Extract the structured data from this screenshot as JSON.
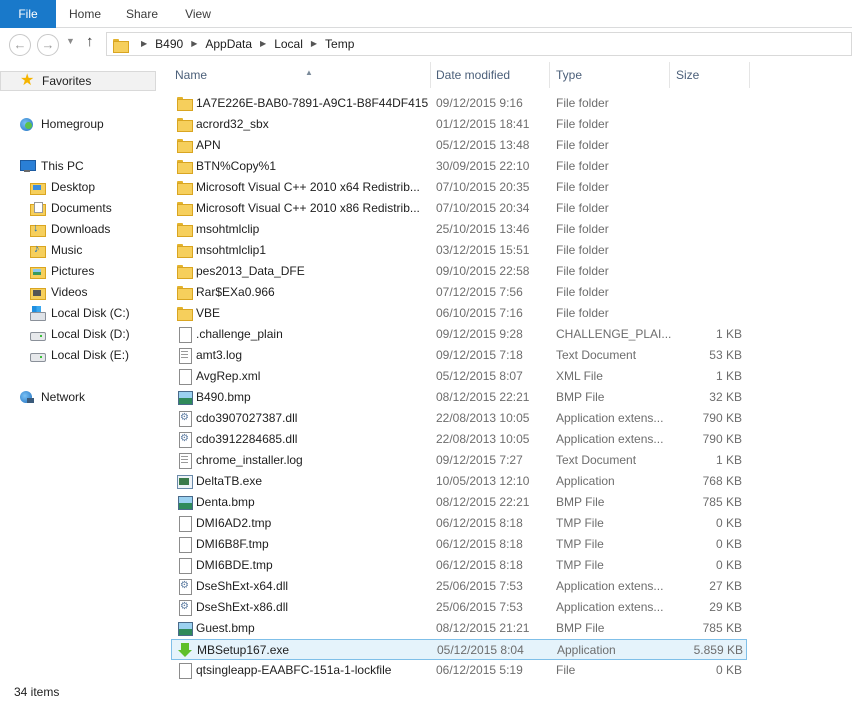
{
  "ribbon": {
    "file": "File",
    "home": "Home",
    "share": "Share",
    "view": "View"
  },
  "address": {
    "crumbs": [
      "B490",
      "AppData",
      "Local",
      "Temp"
    ]
  },
  "sidebar": {
    "favorites": "Favorites",
    "homegroup": "Homegroup",
    "this_pc": "This PC",
    "pc_items": [
      "Desktop",
      "Documents",
      "Downloads",
      "Music",
      "Pictures",
      "Videos",
      "Local Disk (C:)",
      "Local Disk (D:)",
      "Local Disk (E:)"
    ],
    "network": "Network"
  },
  "columns": {
    "name": "Name",
    "date": "Date modified",
    "type": "Type",
    "size": "Size"
  },
  "files": [
    {
      "name": "1A7E226E-BAB0-7891-A9C1-B8F44DF415...",
      "date": "09/12/2015 9:16",
      "type": "File folder",
      "size": "",
      "icon": "folder-icon"
    },
    {
      "name": "acrord32_sbx",
      "date": "01/12/2015 18:41",
      "type": "File folder",
      "size": "",
      "icon": "folder-icon"
    },
    {
      "name": "APN",
      "date": "05/12/2015 13:48",
      "type": "File folder",
      "size": "",
      "icon": "folder-icon"
    },
    {
      "name": "BTN%Copy%1",
      "date": "30/09/2015 22:10",
      "type": "File folder",
      "size": "",
      "icon": "folder-icon"
    },
    {
      "name": "Microsoft Visual C++ 2010  x64 Redistrib...",
      "date": "07/10/2015 20:35",
      "type": "File folder",
      "size": "",
      "icon": "folder-icon"
    },
    {
      "name": "Microsoft Visual C++ 2010  x86 Redistrib...",
      "date": "07/10/2015 20:34",
      "type": "File folder",
      "size": "",
      "icon": "folder-icon"
    },
    {
      "name": "msohtmlclip",
      "date": "25/10/2015 13:46",
      "type": "File folder",
      "size": "",
      "icon": "folder-icon"
    },
    {
      "name": "msohtmlclip1",
      "date": "03/12/2015 15:51",
      "type": "File folder",
      "size": "",
      "icon": "folder-icon"
    },
    {
      "name": "pes2013_Data_DFE",
      "date": "09/10/2015 22:58",
      "type": "File folder",
      "size": "",
      "icon": "folder-icon"
    },
    {
      "name": "Rar$EXa0.966",
      "date": "07/12/2015 7:56",
      "type": "File folder",
      "size": "",
      "icon": "folder-icon"
    },
    {
      "name": "VBE",
      "date": "06/10/2015 7:16",
      "type": "File folder",
      "size": "",
      "icon": "folder-icon"
    },
    {
      "name": ".challenge_plain",
      "date": "09/12/2015 9:28",
      "type": "CHALLENGE_PLAI...",
      "size": "1 KB",
      "icon": "file-icon"
    },
    {
      "name": "amt3.log",
      "date": "09/12/2015 7:18",
      "type": "Text Document",
      "size": "53 KB",
      "icon": "text-file-icon"
    },
    {
      "name": "AvgRep.xml",
      "date": "05/12/2015 8:07",
      "type": "XML File",
      "size": "1 KB",
      "icon": "file-icon"
    },
    {
      "name": "B490.bmp",
      "date": "08/12/2015 22:21",
      "type": "BMP File",
      "size": "32 KB",
      "icon": "image-file-icon"
    },
    {
      "name": "cdo3907027387.dll",
      "date": "22/08/2013 10:05",
      "type": "Application extens...",
      "size": "790 KB",
      "icon": "dll-file-icon"
    },
    {
      "name": "cdo3912284685.dll",
      "date": "22/08/2013 10:05",
      "type": "Application extens...",
      "size": "790 KB",
      "icon": "dll-file-icon"
    },
    {
      "name": "chrome_installer.log",
      "date": "09/12/2015 7:27",
      "type": "Text Document",
      "size": "1 KB",
      "icon": "text-file-icon"
    },
    {
      "name": "DeltaTB.exe",
      "date": "10/05/2013 12:10",
      "type": "Application",
      "size": "768 KB",
      "icon": "exe-file-icon"
    },
    {
      "name": "Denta.bmp",
      "date": "08/12/2015 22:21",
      "type": "BMP File",
      "size": "785 KB",
      "icon": "image-file-icon"
    },
    {
      "name": "DMI6AD2.tmp",
      "date": "06/12/2015 8:18",
      "type": "TMP File",
      "size": "0 KB",
      "icon": "file-icon"
    },
    {
      "name": "DMI6B8F.tmp",
      "date": "06/12/2015 8:18",
      "type": "TMP File",
      "size": "0 KB",
      "icon": "file-icon"
    },
    {
      "name": "DMI6BDE.tmp",
      "date": "06/12/2015 8:18",
      "type": "TMP File",
      "size": "0 KB",
      "icon": "file-icon"
    },
    {
      "name": "DseShExt-x64.dll",
      "date": "25/06/2015 7:53",
      "type": "Application extens...",
      "size": "27 KB",
      "icon": "dll-file-icon"
    },
    {
      "name": "DseShExt-x86.dll",
      "date": "25/06/2015 7:53",
      "type": "Application extens...",
      "size": "29 KB",
      "icon": "dll-file-icon"
    },
    {
      "name": "Guest.bmp",
      "date": "08/12/2015 21:21",
      "type": "BMP File",
      "size": "785 KB",
      "icon": "image-file-icon"
    },
    {
      "name": "MBSetup167.exe",
      "date": "05/12/2015 8:04",
      "type": "Application",
      "size": "5.859 KB",
      "icon": "setup-exe-icon",
      "selected": true
    },
    {
      "name": "qtsingleapp-EAABFC-151a-1-lockfile",
      "date": "06/12/2015 5:19",
      "type": "File",
      "size": "0 KB",
      "icon": "file-icon"
    }
  ],
  "status": {
    "items": "34 items"
  },
  "colors": {
    "file_tab": "#1979ca",
    "selection_fill": "#e5f3fb",
    "selection_border": "#7fbfe8",
    "header_text": "#4c607a"
  }
}
